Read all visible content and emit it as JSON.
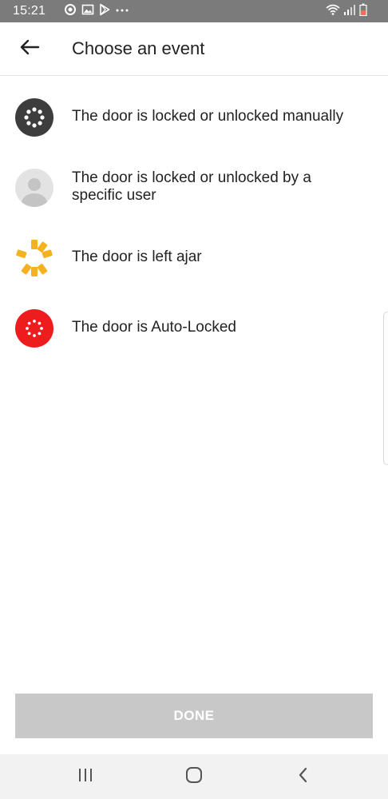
{
  "status_bar": {
    "time": "15:21",
    "left_icons": [
      "sync-icon",
      "image-icon",
      "play-store-icon",
      "more-dots-icon"
    ],
    "right_icons": [
      "wifi-icon",
      "signal-icon",
      "battery-icon"
    ]
  },
  "app_bar": {
    "back_icon": "arrow-left-icon",
    "title": "Choose an event"
  },
  "events": [
    {
      "label": "The door is locked or unlocked manually",
      "icon": "manual-lock-icon",
      "color": "#3d3d3d"
    },
    {
      "label": "The door is locked or unlocked by a specific user",
      "icon": "user-avatar-icon",
      "color": "#e3e3e3"
    },
    {
      "label": "The door is left ajar",
      "icon": "ajar-icon",
      "color": "#f5b21f"
    },
    {
      "label": "The door is Auto-Locked",
      "icon": "auto-lock-icon",
      "color": "#ee1c1c"
    }
  ],
  "done_button": {
    "label": "DONE",
    "bg_color": "#c8c8c8"
  },
  "nav_bar": {
    "recents_icon": "recents-icon",
    "home_icon": "home-icon",
    "back_icon": "back-chevron-icon"
  }
}
